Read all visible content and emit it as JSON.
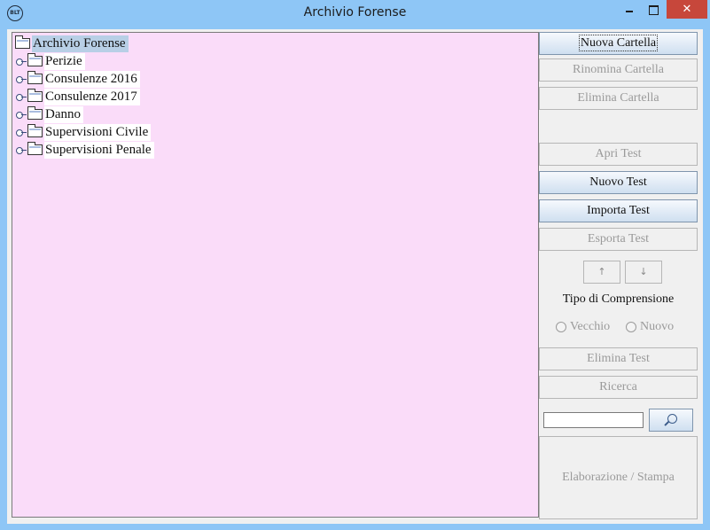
{
  "window": {
    "title": "Archivio Forense",
    "icon_text": "BLT",
    "close_glyph": "✕"
  },
  "tree": {
    "root": "Archivio Forense",
    "items": [
      "Perizie",
      "Consulenze 2016",
      "Consulenze 2017",
      "Danno",
      "Supervisioni Civile",
      "Supervisioni Penale"
    ]
  },
  "sidebar": {
    "nuova_cartella": "Nuova Cartella",
    "rinomina_cartella": "Rinomina Cartella",
    "elimina_cartella": "Elimina Cartella",
    "apri_test": "Apri Test",
    "nuovo_test": "Nuovo Test",
    "importa_test": "Importa Test",
    "esporta_test": "Esporta Test",
    "up_glyph": "↑",
    "down_glyph": "↓",
    "tipo_label": "Tipo di Comprensione",
    "radio_vecchio": "Vecchio",
    "radio_nuovo": "Nuovo",
    "elimina_test": "Elimina Test",
    "ricerca": "Ricerca",
    "search_value": "",
    "elaborazione": "Elaborazione / Stampa"
  },
  "icons": {
    "folder": "folder-icon",
    "tree_handle": "tree-handle-icon",
    "search": "search-icon"
  }
}
